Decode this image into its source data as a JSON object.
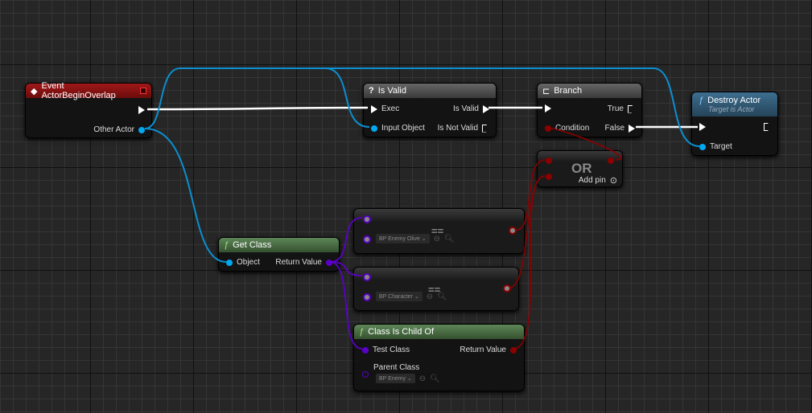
{
  "colors": {
    "exec": "#ffffff",
    "object": "#00a8f0",
    "class": "#5b00c8",
    "bool": "#8c0000",
    "event_header": "#8a1010",
    "func_green": "#4d6e48",
    "func_blue": "#325a78"
  },
  "nodes": {
    "event": {
      "title": "Event ActorBeginOverlap",
      "icon": "event-diamond-icon",
      "pin_other_actor": "Other Actor"
    },
    "is_valid": {
      "title": "Is Valid",
      "icon": "question-icon",
      "pin_exec": "Exec",
      "pin_input": "Input Object",
      "pin_is_valid": "Is Valid",
      "pin_is_not_valid": "Is Not Valid"
    },
    "branch": {
      "title": "Branch",
      "icon": "branch-icon",
      "pin_condition": "Condition",
      "pin_true": "True",
      "pin_false": "False"
    },
    "destroy": {
      "title": "Destroy Actor",
      "subtitle": "Target is Actor",
      "pin_target": "Target"
    },
    "or": {
      "title": "OR",
      "add_pin": "Add pin"
    },
    "get_class": {
      "title": "Get Class",
      "pin_object": "Object",
      "pin_return": "Return Value"
    },
    "equal1": {
      "symbol": "==",
      "value": "BP Enemy Olive"
    },
    "equal2": {
      "symbol": "==",
      "value": "BP Character"
    },
    "child_of": {
      "title": "Class Is Child Of",
      "pin_test": "Test Class",
      "pin_parent": "Parent Class",
      "pin_return": "Return Value",
      "value": "BP Enemy"
    }
  }
}
